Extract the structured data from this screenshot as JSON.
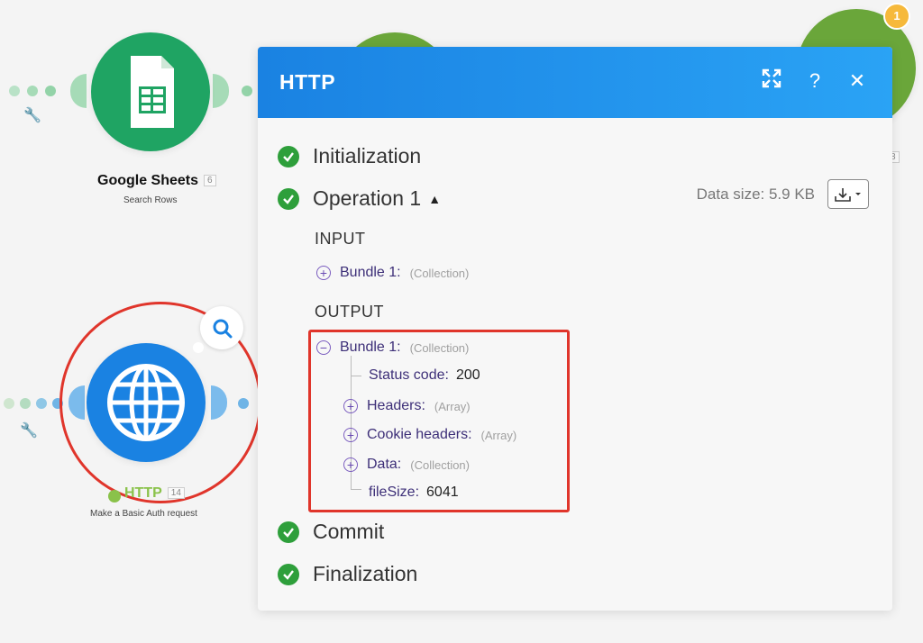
{
  "canvas": {
    "google_sheets": {
      "title": "Google Sheets",
      "badge": "6",
      "subtitle": "Search Rows",
      "color": "#1fa463"
    },
    "http_node": {
      "title": "HTTP",
      "badge": "14",
      "subtitle": "Make a Basic Auth request",
      "color": "#1a82e2",
      "title_color": "#8ac24a"
    },
    "right_node": {
      "badge": "8",
      "notification": "1",
      "color": "#6aa63a",
      "notification_color": "#f6b93b"
    },
    "middle_node_color": "#6aa63a"
  },
  "panel": {
    "title": "HTTP",
    "header_buttons": [
      {
        "name": "expand-icon",
        "glyph": "⤢"
      },
      {
        "name": "help-icon",
        "glyph": "?"
      },
      {
        "name": "close-icon",
        "glyph": "✕"
      }
    ],
    "phases": {
      "initialization": "Initialization",
      "operation": "Operation 1",
      "commit": "Commit",
      "finalization": "Finalization"
    },
    "data_size": "Data size: 5.9 KB",
    "input": {
      "label": "INPUT",
      "bundle_key": "Bundle 1:",
      "bundle_type": "(Collection)"
    },
    "output": {
      "label": "OUTPUT",
      "bundle_key": "Bundle 1:",
      "bundle_type": "(Collection)",
      "items": [
        {
          "key": "Status code:",
          "value": "200"
        },
        {
          "key": "Headers:",
          "type": "(Array)"
        },
        {
          "key": "Cookie headers:",
          "type": "(Array)"
        },
        {
          "key": "Data:",
          "type": "(Collection)"
        },
        {
          "key": "fileSize:",
          "value": "6041"
        }
      ]
    }
  },
  "colors": {
    "check": "#2e9f3b",
    "highlight": "#e0352b",
    "header_start": "#1a82e2",
    "header_end": "#2aa3f5"
  }
}
